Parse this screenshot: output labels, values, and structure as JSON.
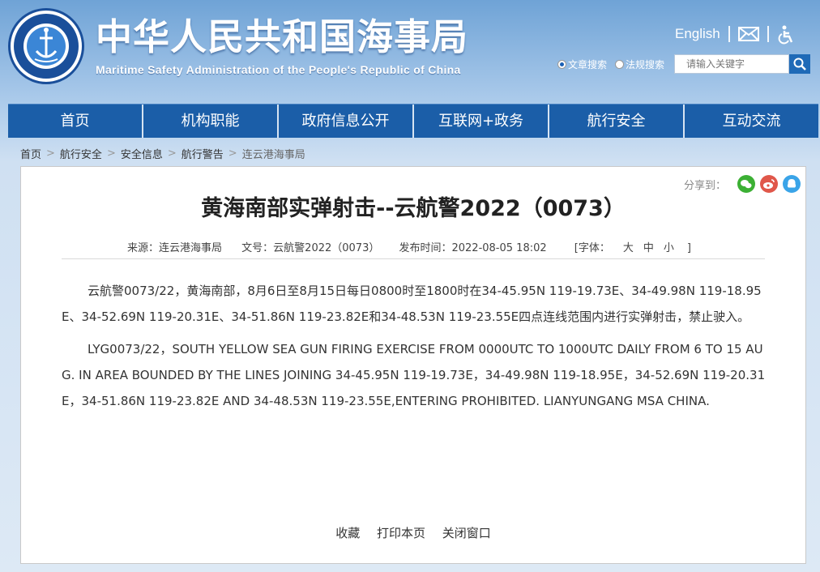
{
  "header": {
    "title": "中华人民共和国海事局",
    "subtitle": "Maritime Safety Administration of the People's Republic of China",
    "emblem_top": "中国海事局",
    "emblem_bottom": "CHINA MSA",
    "lang_link": "English",
    "search": {
      "radio_article": "文章搜索",
      "radio_regulation": "法规搜索",
      "placeholder": "请输入关键字"
    }
  },
  "nav": {
    "items": [
      "首页",
      "机构职能",
      "政府信息公开",
      "互联网+政务",
      "航行安全",
      "互动交流"
    ]
  },
  "breadcrumb": {
    "items": [
      "首页",
      "航行安全",
      "安全信息",
      "航行警告",
      "连云港海事局"
    ]
  },
  "article": {
    "share_label": "分享到：",
    "title": "黄海南部实弹射击--云航警2022（0073）",
    "source": "来源：连云港海事局",
    "doc_no": "文号：云航警2022（0073）",
    "publish_time": "发布时间：2022-08-05 18:02",
    "font_label": "[字体：",
    "font_large": "大",
    "font_mid": "中",
    "font_small": "小",
    "font_end": "]",
    "para_cn": "云航警0073/22，黄海南部，8月6日至8月15日每日0800时至1800时在34-45.95N 119-19.73E、34-49.98N 119-18.95E、34-52.69N 119-20.31E、34-51.86N 119-23.82E和34-48.53N 119-23.55E四点连线范围内进行实弹射击，禁止驶入。",
    "para_en": "LYG0073/22，SOUTH YELLOW SEA GUN FIRING EXERCISE FROM 0000UTC TO 1000UTC DAILY FROM 6 TO 15 AUG. IN AREA BOUNDED BY THE LINES JOINING 34-45.95N 119-19.73E，34-49.98N 119-18.95E，34-52.69N 119-20.31E，34-51.86N 119-23.82E AND 34-48.53N 119-23.55E,ENTERING PROHIBITED. LIANYUNGANG MSA CHINA."
  },
  "footer_actions": {
    "favorite": "收藏",
    "print": "打印本页",
    "close": "关闭窗口"
  },
  "colors": {
    "nav_bg": "#1b5ea8",
    "wechat": "#3cb034",
    "weibo": "#e0574a",
    "qq": "#3aa4e8"
  }
}
